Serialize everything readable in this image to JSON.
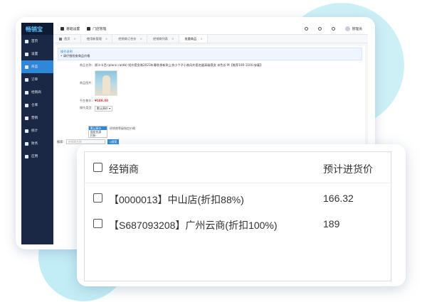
{
  "sidebar": {
    "logo": "畅销宝",
    "items": [
      {
        "label": "首页",
        "icon": "monitor-icon",
        "active": false
      },
      {
        "label": "设置",
        "icon": "gear-icon",
        "active": false
      },
      {
        "label": "商品",
        "icon": "box-icon",
        "active": true
      },
      {
        "label": "订单",
        "icon": "cart-icon",
        "active": false
      },
      {
        "label": "经销商",
        "icon": "user-icon",
        "active": false
      },
      {
        "label": "仓库",
        "icon": "warehouse-icon",
        "active": false
      },
      {
        "label": "营销",
        "icon": "marketing-icon",
        "active": false
      },
      {
        "label": "统计",
        "icon": "chart-icon",
        "active": false
      },
      {
        "label": "财务",
        "icon": "finance-icon",
        "active": false
      },
      {
        "label": "应用",
        "icon": "apps-icon",
        "active": false
      }
    ]
  },
  "topbar": {
    "basic_settings": "基础设置",
    "store_management": "门店管理",
    "user_name": "管理员"
  },
  "tabs": [
    {
      "label": "首页",
      "active": false
    },
    {
      "label": "使用新管理",
      "active": false
    },
    {
      "label": "经销商订合价",
      "active": false
    },
    {
      "label": "经销商列表",
      "active": false
    },
    {
      "label": "批量商品",
      "active": true
    }
  ],
  "content": {
    "tip_title": "操作说明",
    "tip_text": "• 请仔细检查商品价格",
    "product_name_label": "商品名称:",
    "product_name_value": "原汁卡西 (plans cardb) 短外套女装2023年春秋季新款上衣小个子小香风外套名媛高级感女 米色长 M【推荐100-110斤穿着】",
    "product_image_label": "商品图片:",
    "price_label": "平台售价:",
    "price_value": "¥189.00",
    "type_label": "操作类型:",
    "type_selected": "默认原价",
    "dropdown_options": [
      "默认原价",
      "固定优惠",
      "打折"
    ],
    "type_desc": "经销商等级指定价格",
    "search_label": "搜索:",
    "search_placeholder": "经销商名称",
    "search_button": "Q搜索"
  },
  "table": {
    "headers": {
      "dealer": "经销商",
      "price": "预计进货价"
    },
    "rows": [
      {
        "dealer": "【0000013】中山店(折扣88%)",
        "price": "166.32"
      },
      {
        "dealer": "【S687093208】广州云商(折扣100%)",
        "price": "189"
      }
    ]
  }
}
